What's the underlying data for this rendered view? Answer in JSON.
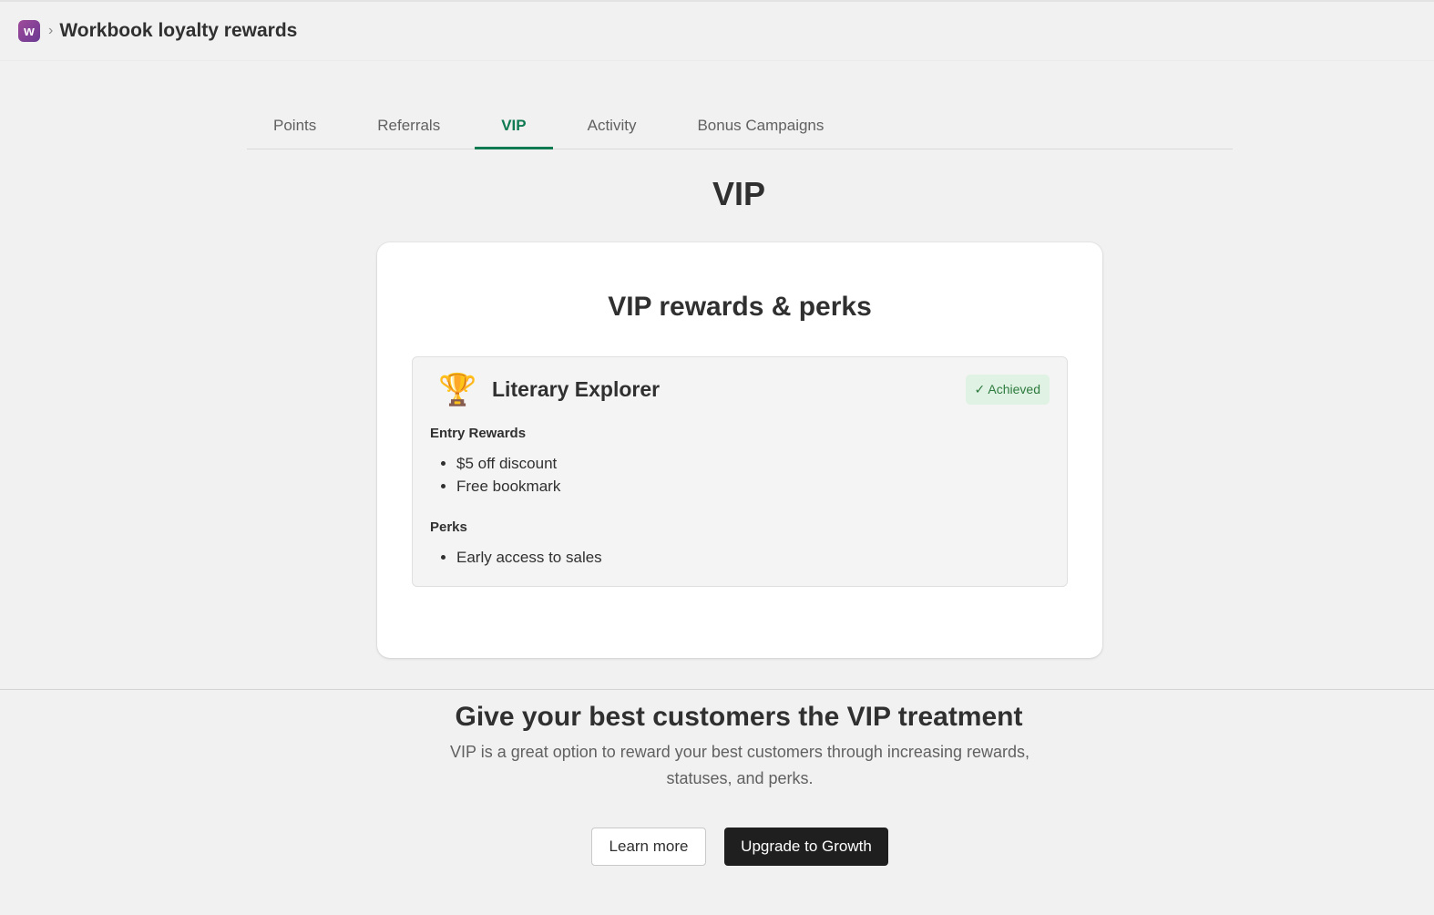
{
  "header": {
    "app_logo_letter": "w",
    "separator": "›",
    "title": "Workbook loyalty rewards"
  },
  "tabs": [
    {
      "label": "Points",
      "active": false
    },
    {
      "label": "Referrals",
      "active": false
    },
    {
      "label": "VIP",
      "active": true
    },
    {
      "label": "Activity",
      "active": false
    },
    {
      "label": "Bonus Campaigns",
      "active": false
    }
  ],
  "page": {
    "heading": "VIP"
  },
  "vip_card": {
    "title": "VIP rewards & perks",
    "tier": {
      "icon": "trophy-icon",
      "icon_glyph": "🏆",
      "name": "Literary Explorer",
      "status": "✓ Achieved",
      "entry_rewards_label": "Entry Rewards",
      "entry_rewards": [
        "$5 off discount",
        "Free bookmark"
      ],
      "perks_label": "Perks",
      "perks": [
        "Early access to sales"
      ]
    }
  },
  "promo": {
    "heading": "Give your best customers the VIP treatment",
    "text": "VIP is a great option to reward your best customers through increasing rewards, statuses, and perks.",
    "learn_more": "Learn more",
    "upgrade": "Upgrade to Growth"
  },
  "colors": {
    "accent": "#0e7a52",
    "badge_bg": "#dff2e3",
    "badge_text": "#2d7a3e",
    "primary_button": "#1f1f1f"
  }
}
